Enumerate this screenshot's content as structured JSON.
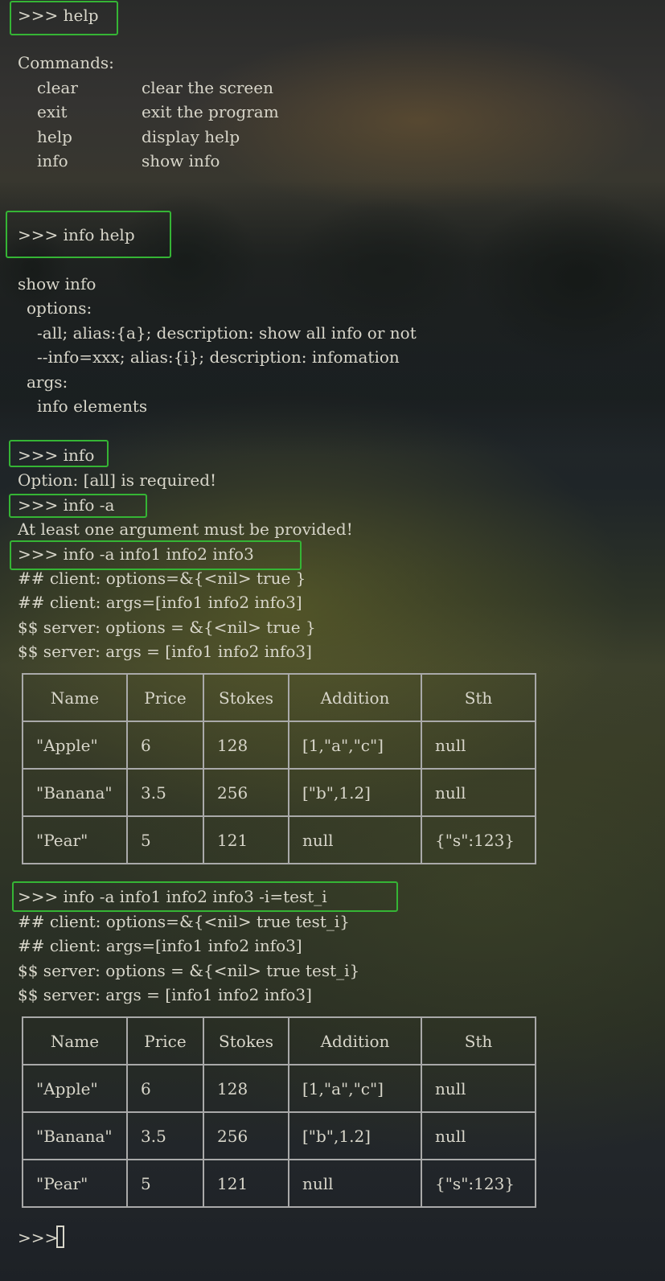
{
  "prompt_symbol": ">>>",
  "session1": {
    "command": "help",
    "heading": "Commands:",
    "commands": [
      {
        "name": "clear",
        "desc": "clear the screen"
      },
      {
        "name": "exit",
        "desc": "exit the program"
      },
      {
        "name": "help",
        "desc": "display help"
      },
      {
        "name": "info",
        "desc": "show info"
      }
    ]
  },
  "session2": {
    "command": "info help",
    "lines": [
      "show info",
      "options:",
      "-all; alias:{a}; description: show all info or not",
      "--info=xxx; alias:{i}; description: infomation",
      "args:",
      "info elements"
    ]
  },
  "session3": {
    "command": "info",
    "output": "Option: [all] is required!"
  },
  "session4": {
    "command": "info -a",
    "output": "At least one argument must be provided!"
  },
  "session5": {
    "command": "info -a info1 info2 info3",
    "lines": [
      "## client: options=&{<nil> true }",
      "## client: args=[info1 info2 info3]",
      "$$ server: options = &{<nil> true }",
      "$$ server: args = [info1 info2 info3]"
    ]
  },
  "session6": {
    "command": "info -a info1 info2 info3 -i=test_i",
    "lines": [
      "## client: options=&{<nil> true test_i}",
      "## client: args=[info1 info2 info3]",
      "$$ server: options = &{<nil> true test_i}",
      "$$ server: args = [info1 info2 info3]"
    ]
  },
  "table": {
    "headers": [
      "Name",
      "Price",
      "Stokes",
      "Addition",
      "Sth"
    ],
    "rows": [
      [
        "\"Apple\"",
        "6",
        "128",
        "[1,\"a\",\"c\"]",
        "null"
      ],
      [
        "\"Banana\"",
        "3.5",
        "256",
        "[\"b\",1.2]",
        "null"
      ],
      [
        "\"Pear\"",
        "5",
        "121",
        "null",
        "{\"s\":123}"
      ]
    ]
  },
  "colors": {
    "highlight_box": "#35b535",
    "text": "#d8d6ca",
    "table_border": "#a9a9a9"
  }
}
